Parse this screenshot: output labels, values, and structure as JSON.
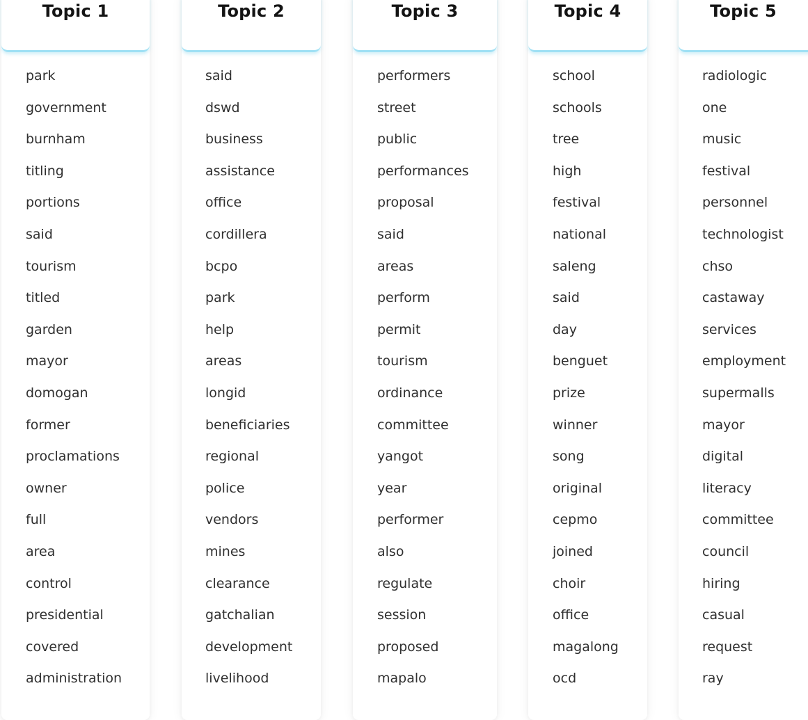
{
  "topics": [
    {
      "title": "Topic 1",
      "words": [
        "park",
        "government",
        "burnham",
        "titling",
        "portions",
        "said",
        "tourism",
        "titled",
        "garden",
        "mayor",
        "domogan",
        "former",
        "proclamations",
        "owner",
        "full",
        "area",
        "control",
        "presidential",
        "covered",
        "administration"
      ]
    },
    {
      "title": "Topic 2",
      "words": [
        "said",
        "dswd",
        "business",
        "assistance",
        "office",
        "cordillera",
        "bcpo",
        "park",
        "help",
        "areas",
        "longid",
        "beneficiaries",
        "regional",
        "police",
        "vendors",
        "mines",
        "clearance",
        "gatchalian",
        "development",
        "livelihood"
      ]
    },
    {
      "title": "Topic 3",
      "words": [
        "performers",
        "street",
        "public",
        "performances",
        "proposal",
        "said",
        "areas",
        "perform",
        "permit",
        "tourism",
        "ordinance",
        "committee",
        "yangot",
        "year",
        "performer",
        "also",
        "regulate",
        "session",
        "proposed",
        "mapalo"
      ]
    },
    {
      "title": "Topic 4",
      "words": [
        "school",
        "schools",
        "tree",
        "high",
        "festival",
        "national",
        "saleng",
        "said",
        "day",
        "benguet",
        "prize",
        "winner",
        "song",
        "original",
        "cepmo",
        "joined",
        "choir",
        "office",
        "magalong",
        "ocd"
      ]
    },
    {
      "title": "Topic 5",
      "words": [
        "radiologic",
        "one",
        "music",
        "festival",
        "personnel",
        "technologist",
        "chso",
        "castaway",
        "services",
        "employment",
        "supermalls",
        "mayor",
        "digital",
        "literacy",
        "committee",
        "council",
        "hiring",
        "casual",
        "request",
        "ray"
      ]
    }
  ]
}
